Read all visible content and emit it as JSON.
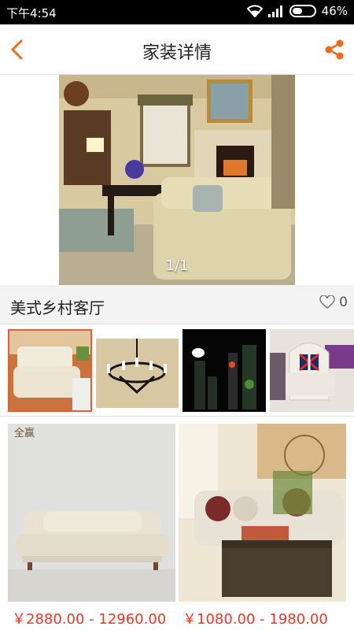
{
  "status": {
    "time": "下午4:54",
    "battery": "46%",
    "battery_level": 0.46
  },
  "header": {
    "title": "家装详情"
  },
  "hero": {
    "counter": "1/1"
  },
  "item": {
    "name": "美式乡村客厅",
    "likes": "0"
  },
  "products": [
    {
      "price": "￥2880.00 - 12960.00",
      "brand": "全赢"
    },
    {
      "price": "￥1080.00 - 1980.00"
    }
  ],
  "colors": {
    "accent": "#f06a1e",
    "price": "#e8392a",
    "selected_border": "#e85a3a"
  }
}
